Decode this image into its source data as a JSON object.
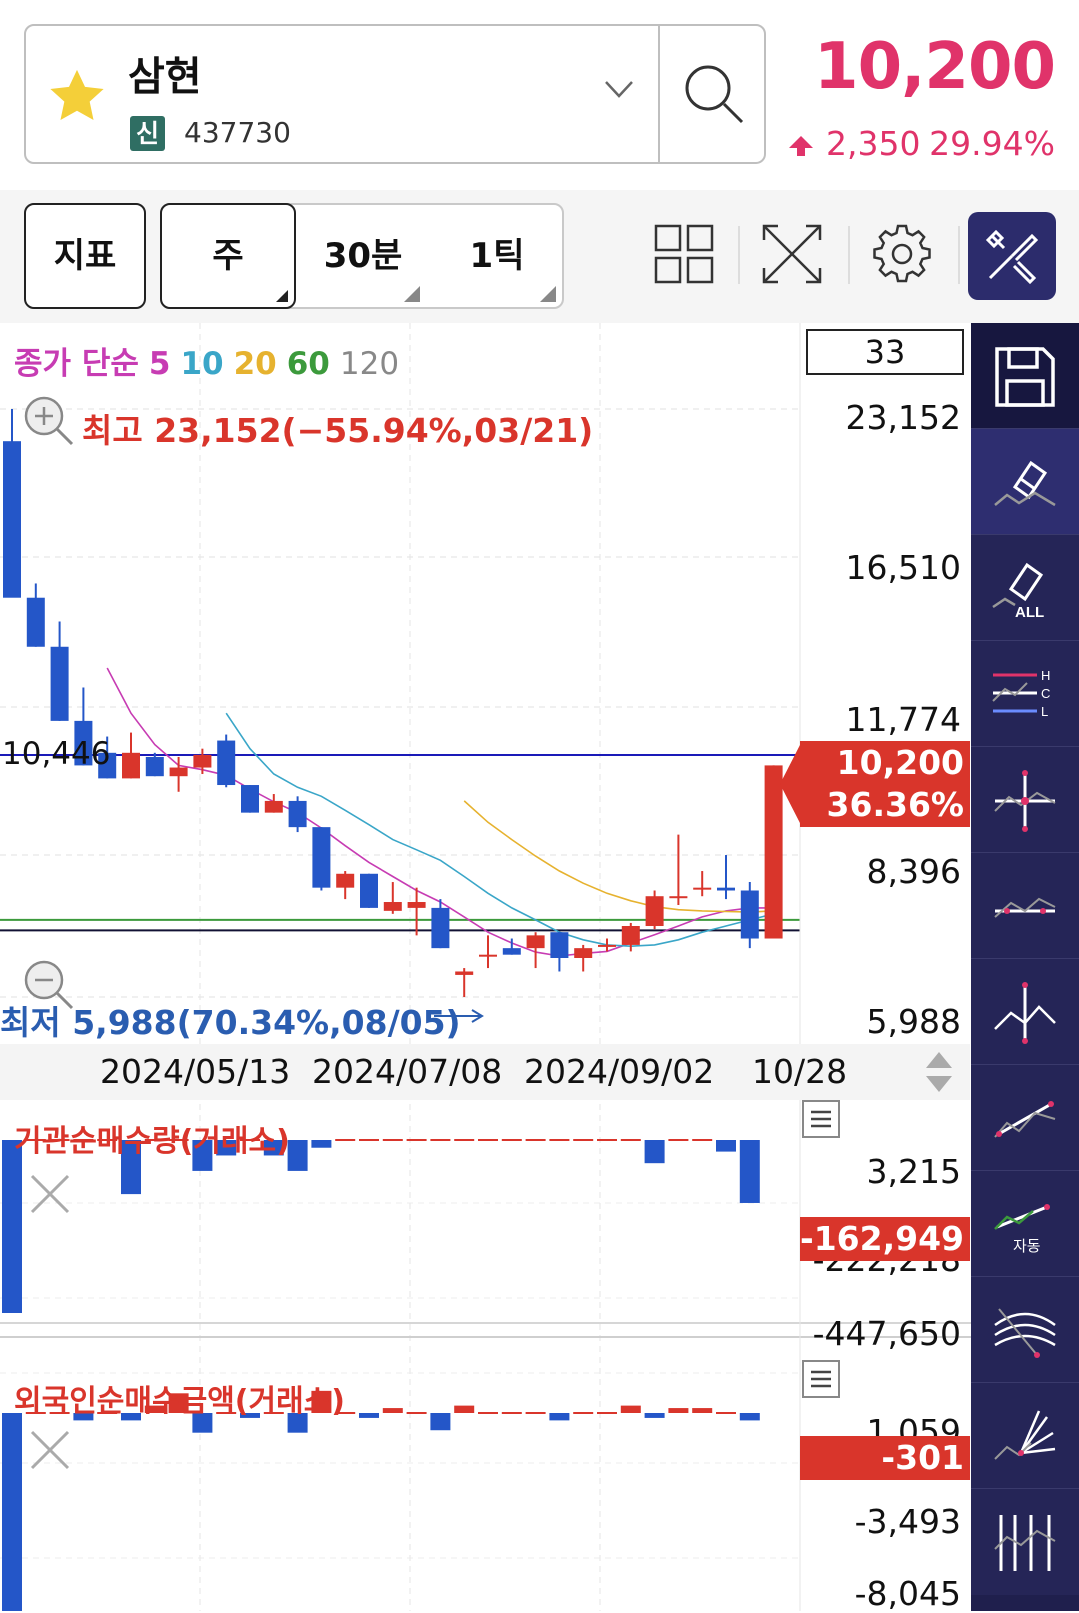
{
  "stock": {
    "name": "삼현",
    "badge": "신",
    "code": "437730"
  },
  "quote": {
    "price": "10,200",
    "change": "2,350",
    "change_pct": "29.94%"
  },
  "toolbar": {
    "indicator": "지표",
    "periods": [
      "주",
      "30분",
      "1틱"
    ],
    "selected_period": "주"
  },
  "chart": {
    "legend": {
      "label": "종가 단순",
      "periods": [
        "5",
        "10",
        "20",
        "60",
        "120"
      ],
      "colors": [
        "#c73cb3",
        "#3aa6c8",
        "#e6b22f",
        "#3c9a3c",
        "#888888"
      ]
    },
    "count": "33",
    "y_ticks": [
      "23,152",
      "16,510",
      "11,774",
      "8,396",
      "5,988"
    ],
    "current_tag": {
      "price": "10,200",
      "pct": "36.36%"
    },
    "high_label": "최고 23,152(−55.94%,03/21)",
    "low_label": "최저 5,988(70.34%,08/05)",
    "hline_label": "10,446",
    "x_labels": [
      "2024/05/13",
      "2024/07/08",
      "2024/09/02",
      "10/28"
    ]
  },
  "panel_institution": {
    "title": "기관순매수량(거래소)",
    "y_ticks": [
      "3,215",
      "-222,218",
      "-447,650"
    ],
    "current": "-162,949"
  },
  "panel_foreign": {
    "title": "외국인순매수금액(거래소)",
    "y_ticks": [
      "1,059",
      "-3,493",
      "-8,045"
    ],
    "current": "-301"
  },
  "sidebar_tools": [
    "save-icon",
    "eraser-icon",
    "eraser-all-icon",
    "hcl-lines-icon",
    "crosshair-icon",
    "peak-line-icon",
    "pivot-icon",
    "trendline-icon",
    "auto-trendline-icon",
    "fibonacci-arc-icon",
    "fan-lines-icon",
    "vertical-lines-icon"
  ],
  "sidebar_badges": {
    "all": "ALL",
    "auto": "자동",
    "hcl": [
      "H",
      "C",
      "L"
    ]
  },
  "chart_data": {
    "type": "candlestick",
    "y_scale": "log",
    "ylim": [
      5988,
      23152
    ],
    "candles": [
      {
        "o": 21500,
        "h": 23152,
        "l": 15800,
        "c": 15000,
        "up": false
      },
      {
        "o": 15000,
        "h": 15500,
        "l": 13400,
        "c": 13400,
        "up": false
      },
      {
        "o": 13400,
        "h": 14200,
        "l": 11300,
        "c": 11300,
        "up": false
      },
      {
        "o": 11300,
        "h": 12200,
        "l": 10200,
        "c": 10200,
        "up": false
      },
      {
        "o": 10500,
        "h": 10900,
        "l": 9900,
        "c": 9900,
        "up": false
      },
      {
        "o": 9900,
        "h": 11000,
        "l": 9900,
        "c": 10500,
        "up": true
      },
      {
        "o": 10400,
        "h": 10500,
        "l": 9950,
        "c": 9950,
        "up": false
      },
      {
        "o": 9950,
        "h": 10400,
        "l": 9600,
        "c": 10150,
        "up": true
      },
      {
        "o": 10150,
        "h": 10600,
        "l": 10000,
        "c": 10450,
        "up": true
      },
      {
        "o": 10800,
        "h": 10950,
        "l": 9700,
        "c": 9750,
        "up": false
      },
      {
        "o": 9750,
        "h": 9750,
        "l": 9150,
        "c": 9150,
        "up": false
      },
      {
        "o": 9150,
        "h": 9550,
        "l": 9150,
        "c": 9400,
        "up": true
      },
      {
        "o": 9400,
        "h": 9500,
        "l": 8750,
        "c": 8850,
        "up": false
      },
      {
        "o": 8850,
        "h": 8850,
        "l": 7650,
        "c": 7700,
        "up": false
      },
      {
        "o": 7700,
        "h": 8000,
        "l": 7500,
        "c": 7950,
        "up": true
      },
      {
        "o": 7950,
        "h": 7950,
        "l": 7350,
        "c": 7350,
        "up": false
      },
      {
        "o": 7300,
        "h": 7800,
        "l": 7250,
        "c": 7450,
        "up": true
      },
      {
        "o": 7450,
        "h": 7700,
        "l": 6900,
        "c": 7350,
        "up": true
      },
      {
        "o": 7350,
        "h": 7500,
        "l": 6700,
        "c": 6700,
        "up": false
      },
      {
        "o": 6350,
        "h": 6400,
        "l": 5988,
        "c": 6300,
        "up": true
      },
      {
        "o": 6600,
        "h": 6900,
        "l": 6400,
        "c": 6600,
        "up": true
      },
      {
        "o": 6600,
        "h": 6850,
        "l": 6600,
        "c": 6700,
        "up": false
      },
      {
        "o": 6700,
        "h": 6950,
        "l": 6400,
        "c": 6900,
        "up": true
      },
      {
        "o": 6950,
        "h": 6950,
        "l": 6350,
        "c": 6550,
        "up": false
      },
      {
        "o": 6550,
        "h": 6750,
        "l": 6350,
        "c": 6700,
        "up": true
      },
      {
        "o": 6750,
        "h": 6850,
        "l": 6650,
        "c": 6750,
        "up": true
      },
      {
        "o": 6750,
        "h": 7100,
        "l": 6650,
        "c": 7050,
        "up": true
      },
      {
        "o": 7050,
        "h": 7650,
        "l": 7000,
        "c": 7550,
        "up": true
      },
      {
        "o": 7550,
        "h": 8700,
        "l": 7400,
        "c": 7550,
        "up": true
      },
      {
        "o": 7700,
        "h": 8000,
        "l": 7550,
        "c": 7700,
        "up": true
      },
      {
        "o": 7700,
        "h": 8300,
        "l": 7500,
        "c": 7650,
        "up": false
      },
      {
        "o": 7650,
        "h": 7800,
        "l": 6700,
        "c": 6850,
        "up": false
      },
      {
        "o": 6850,
        "h": 10200,
        "l": 6850,
        "c": 10200,
        "up": true
      }
    ],
    "h_lines": [
      {
        "value": 10446,
        "color": "#1a1ab8"
      },
      {
        "value": 7150,
        "color": "#3c9a3c"
      },
      {
        "value": 6980,
        "color": "#111133"
      }
    ],
    "ma5": [
      null,
      null,
      null,
      null,
      12760,
      11500,
      10700,
      10200,
      10100,
      9970,
      9660,
      9380,
      9150,
      8830,
      8480,
      8160,
      7900,
      7650,
      7450,
      7200,
      6950,
      6780,
      6640,
      6580,
      6620,
      6650,
      6780,
      6910,
      7050,
      7200,
      7300,
      7350,
      7350
    ],
    "ma10": [
      null,
      null,
      null,
      null,
      null,
      null,
      null,
      null,
      null,
      11500,
      10600,
      10000,
      9700,
      9500,
      9200,
      8900,
      8600,
      8400,
      8200,
      7900,
      7600,
      7350,
      7150,
      6950,
      6830,
      6750,
      6730,
      6750,
      6830,
      6950,
      7050,
      7150,
      7250
    ],
    "ma20": [
      null,
      null,
      null,
      null,
      null,
      null,
      null,
      null,
      null,
      null,
      null,
      null,
      null,
      null,
      null,
      null,
      null,
      null,
      null,
      9400,
      8950,
      8600,
      8280,
      8000,
      7780,
      7600,
      7470,
      7370,
      7320,
      7300,
      7290,
      7280,
      7300
    ],
    "institution": [
      -447650,
      0,
      0,
      0,
      0,
      -140000,
      0,
      0,
      -80000,
      -40000,
      0,
      -40000,
      -80000,
      -20000,
      0,
      0,
      0,
      0,
      0,
      0,
      0,
      0,
      0,
      0,
      0,
      0,
      0,
      -60000,
      0,
      0,
      -30000,
      -162949
    ],
    "foreign": [
      -8045,
      0,
      0,
      -300,
      0,
      -300,
      300,
      800,
      -800,
      0,
      -200,
      0,
      -800,
      900,
      0,
      -200,
      200,
      0,
      -700,
      300,
      0,
      0,
      0,
      -300,
      0,
      0,
      300,
      -200,
      200,
      200,
      0,
      -301
    ]
  }
}
